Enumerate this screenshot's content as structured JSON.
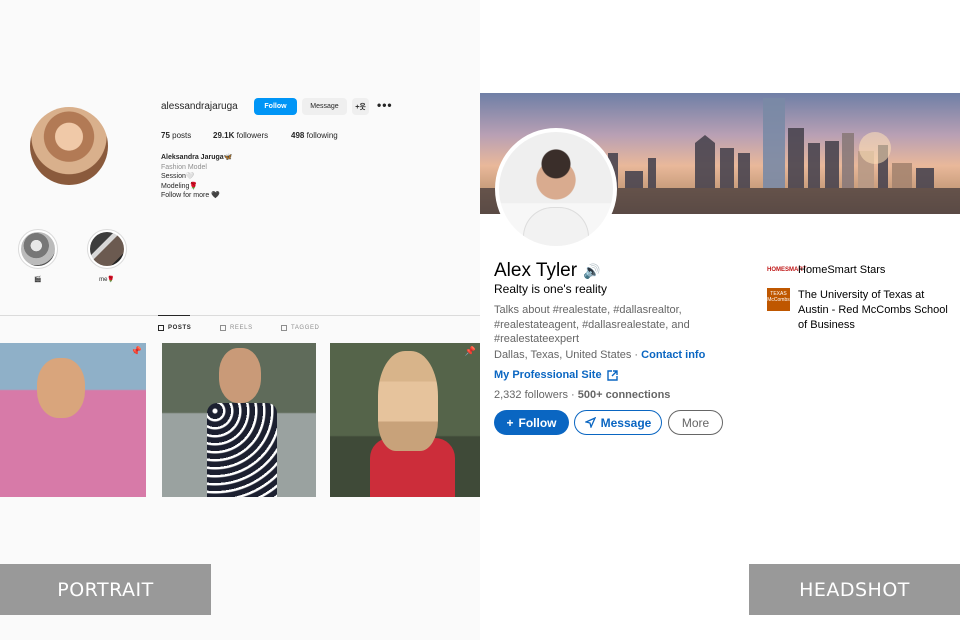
{
  "instagram": {
    "username": "alessandrajaruga",
    "follow_label": "Follow",
    "message_label": "Message",
    "add_user_label": "+웃",
    "more_label": "•••",
    "stats": {
      "posts": "75",
      "posts_label": " posts",
      "followers": "29.1K",
      "followers_label": " followers",
      "following": "498",
      "following_label": " following"
    },
    "bio": {
      "name": "Aleksandra Jaruga🦋",
      "category": "Fashion Model",
      "line1": "Session🤍",
      "line2": "Modeling🌹",
      "line3": "Follow for more 🖤"
    },
    "highlights": [
      {
        "label": "🎬"
      },
      {
        "label": "me🌹"
      }
    ],
    "tabs": {
      "posts": "POSTS",
      "reels": "REELS",
      "tagged": "TAGGED"
    },
    "pin_icon": "📌"
  },
  "labels": {
    "left": "PORTRAIT",
    "right": "HEADSHOT"
  },
  "linkedin": {
    "name": "Alex Tyler",
    "headline": "Realty is one's reality",
    "about": "Talks about #realestate, #dallasrealtor, #realestateagent, #dallasrealestate, and #realestateexpert",
    "location": "Dallas, Texas, United States · ",
    "contact_label": "Contact info",
    "site_label": "My Professional Site",
    "followers": "2,332 followers",
    "connections": "500+ connections",
    "follow_label": "Follow",
    "message_label": "Message",
    "more_label": "More",
    "orgs": [
      {
        "name": "HomeSmart Stars",
        "logo_text": "HOMESMART"
      },
      {
        "name": "The University of Texas at Austin - Red McCombs School of Business",
        "logo_text": "TEXAS McCombs"
      }
    ]
  }
}
